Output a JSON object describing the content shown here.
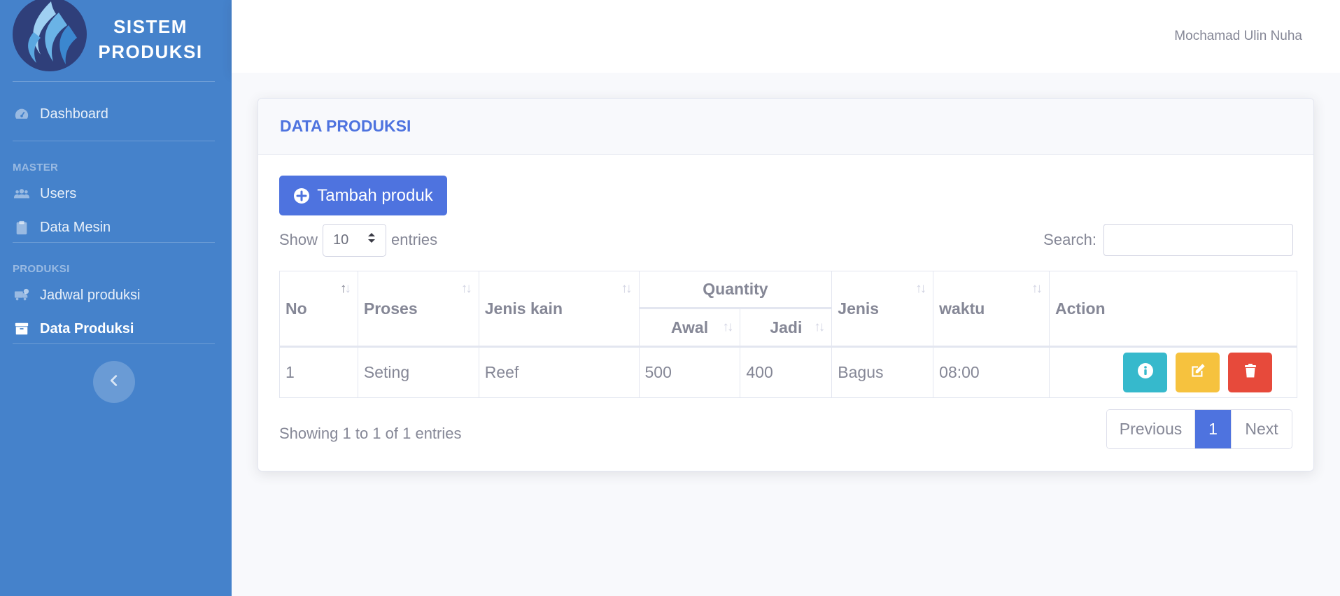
{
  "brand": {
    "line1": "SISTEM",
    "line2": "PRODUKSI"
  },
  "sidebar": {
    "dashboard": "Dashboard",
    "heading_master": "MASTER",
    "users": "Users",
    "data_mesin": "Data Mesin",
    "heading_produksi": "PRODUKSI",
    "jadwal": "Jadwal produksi",
    "data_produksi": "Data Produksi"
  },
  "topbar": {
    "user": "Mochamad Ulin Nuha"
  },
  "card": {
    "title": "DATA PRODUKSI",
    "add_button": "Tambah produk",
    "show": "Show",
    "entries": "entries",
    "page_length": "10",
    "search_label": "Search:",
    "search_value": ""
  },
  "table": {
    "headers": {
      "no": "No",
      "proses": "Proses",
      "jenis_kain": "Jenis kain",
      "quantity": "Quantity",
      "awal": "Awal",
      "jadi": "Jadi",
      "jenis": "Jenis",
      "waktu": "waktu",
      "action": "Action"
    },
    "rows": [
      {
        "no": "1",
        "proses": "Seting",
        "jenis_kain": "Reef",
        "awal": "500",
        "jadi": "400",
        "jenis": "Bagus",
        "waktu": "08:00"
      }
    ]
  },
  "footer": {
    "showing": "Showing 1 to 1 of 1 entries",
    "previous": "Previous",
    "page": "1",
    "next": "Next"
  },
  "colors": {
    "sidebar": "#4582cb",
    "primary": "#4e73df",
    "info": "#36b9cc",
    "warning": "#f6c23e",
    "danger": "#e74a3b"
  },
  "icons": {
    "logo": "water-drop-logo",
    "dashboard": "tachometer-icon",
    "users": "users-icon",
    "data_mesin": "clipboard-icon",
    "jadwal": "truck-clock-icon",
    "data_produksi": "archive-icon",
    "toggle": "chevron-left-icon",
    "add": "plus-circle-icon",
    "info": "info-circle-icon",
    "edit": "edit-icon",
    "delete": "trash-icon"
  }
}
